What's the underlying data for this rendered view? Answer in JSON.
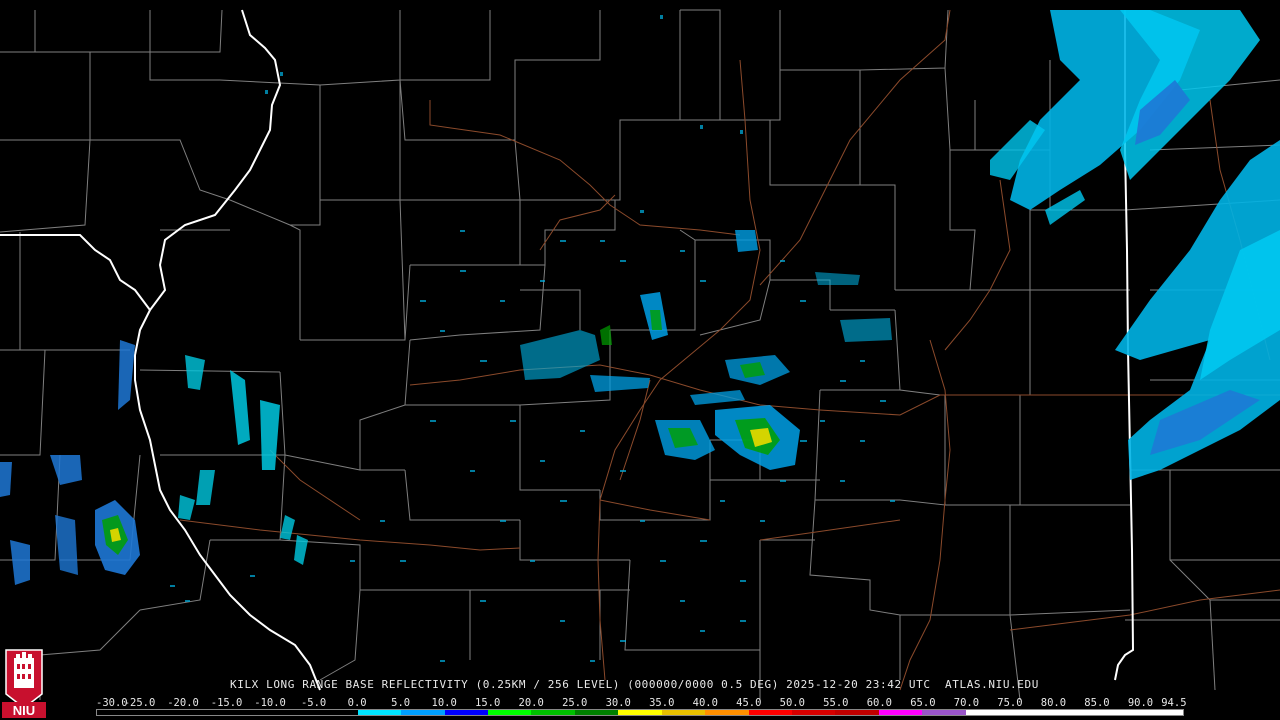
{
  "product": {
    "caption": "KILX LONG RANGE BASE REFLECTIVITY (0.25KM / 256 LEVEL) (000000/0000 0.5 DEG) 2025-12-20 23:42 UTC  ATLAS.NIU.EDU"
  },
  "logo": {
    "text": "NIU",
    "colors": {
      "background": "#c8102e",
      "shield": "#c8102e",
      "text": "#ffffff"
    }
  },
  "color_scale": {
    "labels": [
      "-30.0",
      "-25.0",
      "-20.0",
      "-15.0",
      "-10.0",
      "-5.0",
      "0.0",
      "5.0",
      "10.0",
      "15.0",
      "20.0",
      "25.0",
      "30.0",
      "35.0",
      "40.0",
      "45.0",
      "50.0",
      "55.0",
      "60.0",
      "65.0",
      "70.0",
      "75.0",
      "80.0",
      "85.0",
      "90.0",
      "94.5"
    ],
    "colors": [
      "#000000",
      "#000000",
      "#000000",
      "#000000",
      "#000000",
      "#000000",
      "#00e4ff",
      "#00a0ff",
      "#0000ff",
      "#00ff00",
      "#00c000",
      "#008000",
      "#ffff00",
      "#e7c000",
      "#ff9000",
      "#ff0000",
      "#d60000",
      "#c00000",
      "#ff00ff",
      "#9955c9",
      "#ffffff",
      "#ffffff",
      "#ffffff",
      "#ffffff",
      "#ffffff"
    ]
  },
  "map_colors": {
    "background": "#000000",
    "county_lines": "#7f7f7f",
    "state_lines": "#ffffff",
    "highways": "#8b4a2b"
  }
}
